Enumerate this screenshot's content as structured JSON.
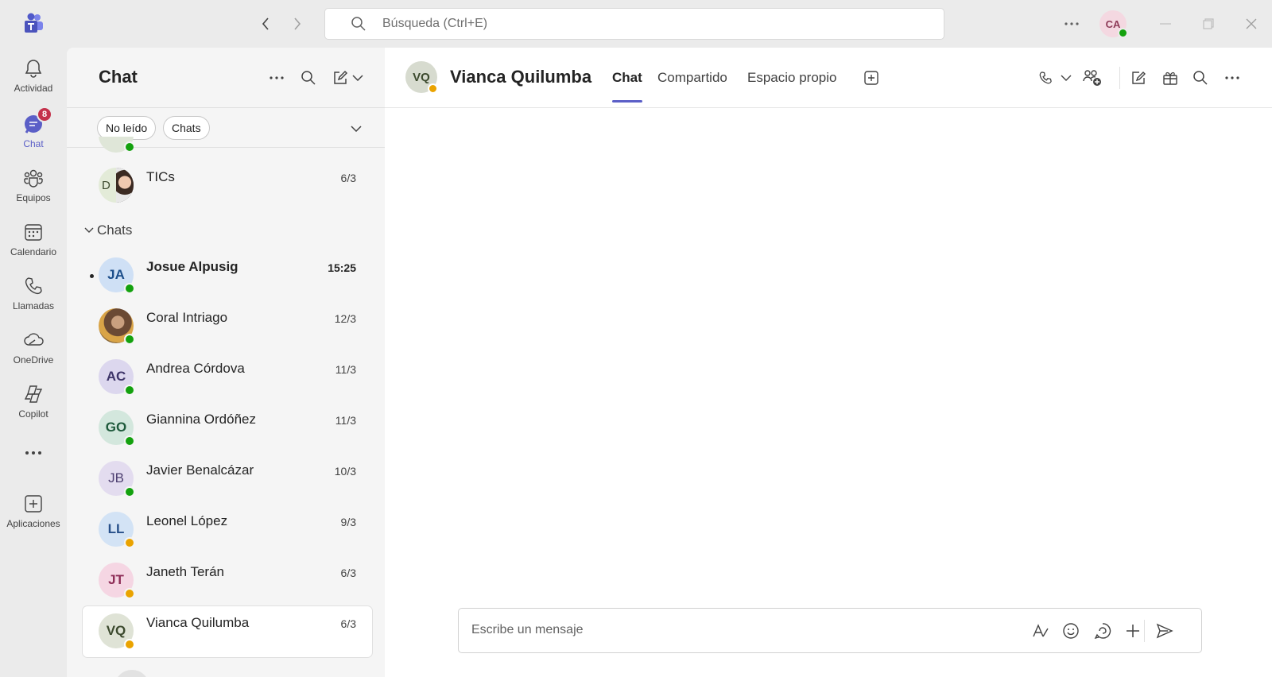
{
  "titlebar": {
    "search_placeholder": "Búsqueda (Ctrl+E)",
    "user_initials": "CA"
  },
  "rail": {
    "items": [
      {
        "label": "Actividad",
        "icon": "bell-icon"
      },
      {
        "label": "Chat",
        "icon": "chat-icon",
        "badge": "8"
      },
      {
        "label": "Equipos",
        "icon": "teams-icon"
      },
      {
        "label": "Calendario",
        "icon": "calendar-icon"
      },
      {
        "label": "Llamadas",
        "icon": "phone-icon"
      },
      {
        "label": "OneDrive",
        "icon": "cloud-icon"
      },
      {
        "label": "Copilot",
        "icon": "copilot-icon"
      },
      {
        "label": "Aplicaciones",
        "icon": "add-apps-icon"
      }
    ]
  },
  "list": {
    "title": "Chat",
    "filters": [
      "No leído",
      "Chats"
    ],
    "pinned": [
      {
        "name": "TICs",
        "time": "6/3",
        "initials": "D"
      }
    ],
    "section_label": "Chats",
    "chats": [
      {
        "name": "Josue Alpusig",
        "time": "15:25",
        "initials": "JA",
        "unread": true,
        "presence": "available"
      },
      {
        "name": "Coral Intriago",
        "time": "12/3",
        "initials": "",
        "unread": false,
        "presence": "available"
      },
      {
        "name": "Andrea Córdova",
        "time": "11/3",
        "initials": "AC",
        "unread": false,
        "presence": "available"
      },
      {
        "name": "Giannina Ordóñez",
        "time": "11/3",
        "initials": "GO",
        "unread": false,
        "presence": "available"
      },
      {
        "name": "Javier Benalcázar",
        "time": "10/3",
        "initials": "JB",
        "unread": false,
        "presence": "available"
      },
      {
        "name": "Leonel López",
        "time": "9/3",
        "initials": "LL",
        "unread": false,
        "presence": "away"
      },
      {
        "name": "Janeth Terán",
        "time": "6/3",
        "initials": "JT",
        "unread": false,
        "presence": "away"
      },
      {
        "name": "Vianca Quilumba",
        "time": "6/3",
        "initials": "VQ",
        "unread": false,
        "presence": "away",
        "selected": true
      }
    ]
  },
  "conversation": {
    "name": "Vianca Quilumba",
    "initials": "VQ",
    "tabs": [
      "Chat",
      "Compartido",
      "Espacio propio"
    ],
    "composer_placeholder": "Escribe un mensaje"
  },
  "colors": {
    "accent": "#5b5fc7",
    "available": "#13a10e",
    "away": "#eaa300",
    "badge": "#c4314b"
  }
}
